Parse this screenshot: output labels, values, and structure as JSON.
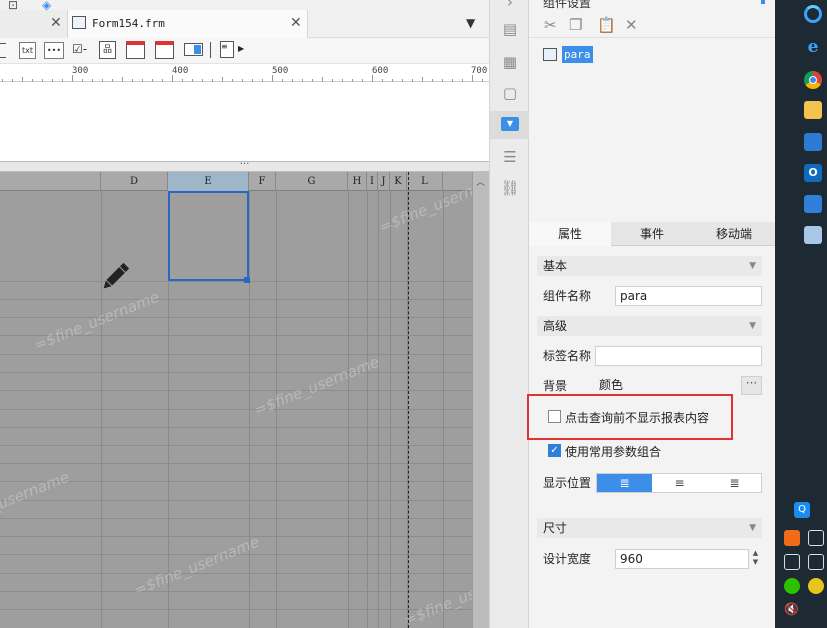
{
  "tabs": {
    "form_tab_label": "Form154.frm",
    "close_glyph": "✕"
  },
  "toolbar": {
    "txt_label": "txt",
    "icons": [
      "text-widget-icon",
      "password-widget-icon",
      "checkbox-widget-icon",
      "tree-widget-icon",
      "date-widget-icon",
      "datetime-widget-icon",
      "dropdown-widget-icon",
      "list-widget-icon"
    ]
  },
  "ruler": {
    "labels": [
      "300",
      "400",
      "500",
      "600",
      "700"
    ]
  },
  "grid": {
    "columns": [
      "D",
      "E",
      "F",
      "G",
      "H",
      "I",
      "J",
      "K",
      "L"
    ],
    "watermark": "=$fine_username"
  },
  "panel": {
    "title": "组件设置",
    "tree_node": "para",
    "tabs": [
      "属性",
      "事件",
      "移动端"
    ],
    "section_basic": "基本",
    "widget_name_label": "组件名称",
    "widget_name_value": "para",
    "section_advanced": "高级",
    "tag_name_label": "标签名称",
    "tag_name_value": "",
    "background_label": "背景",
    "background_value": "颜色",
    "background_more": "···",
    "hide_before_query_label": "点击查询前不显示报表内容",
    "hide_before_query_checked": false,
    "use_param_combo_label": "使用常用参数组合",
    "use_param_combo_checked": true,
    "position_label": "显示位置",
    "align_left": "≣",
    "align_center": "≡",
    "align_right": "≣",
    "section_size": "尺寸",
    "design_width_label": "设计宽度",
    "design_width_value": "960"
  },
  "taskbar": {
    "app_icons": [
      "edge-icon",
      "ie-icon",
      "chrome-icon",
      "file-explorer-icon",
      "remote-desktop-icon",
      "outlook-icon",
      "app-window-icon",
      "notepad-icon"
    ],
    "tray_q": "Q",
    "outlook_letter": "O"
  },
  "colors": {
    "accent": "#3c8ee8",
    "highlight_border": "#e03434",
    "selection": "#2a66c4",
    "taskbar_bg": "#1e2a33"
  }
}
